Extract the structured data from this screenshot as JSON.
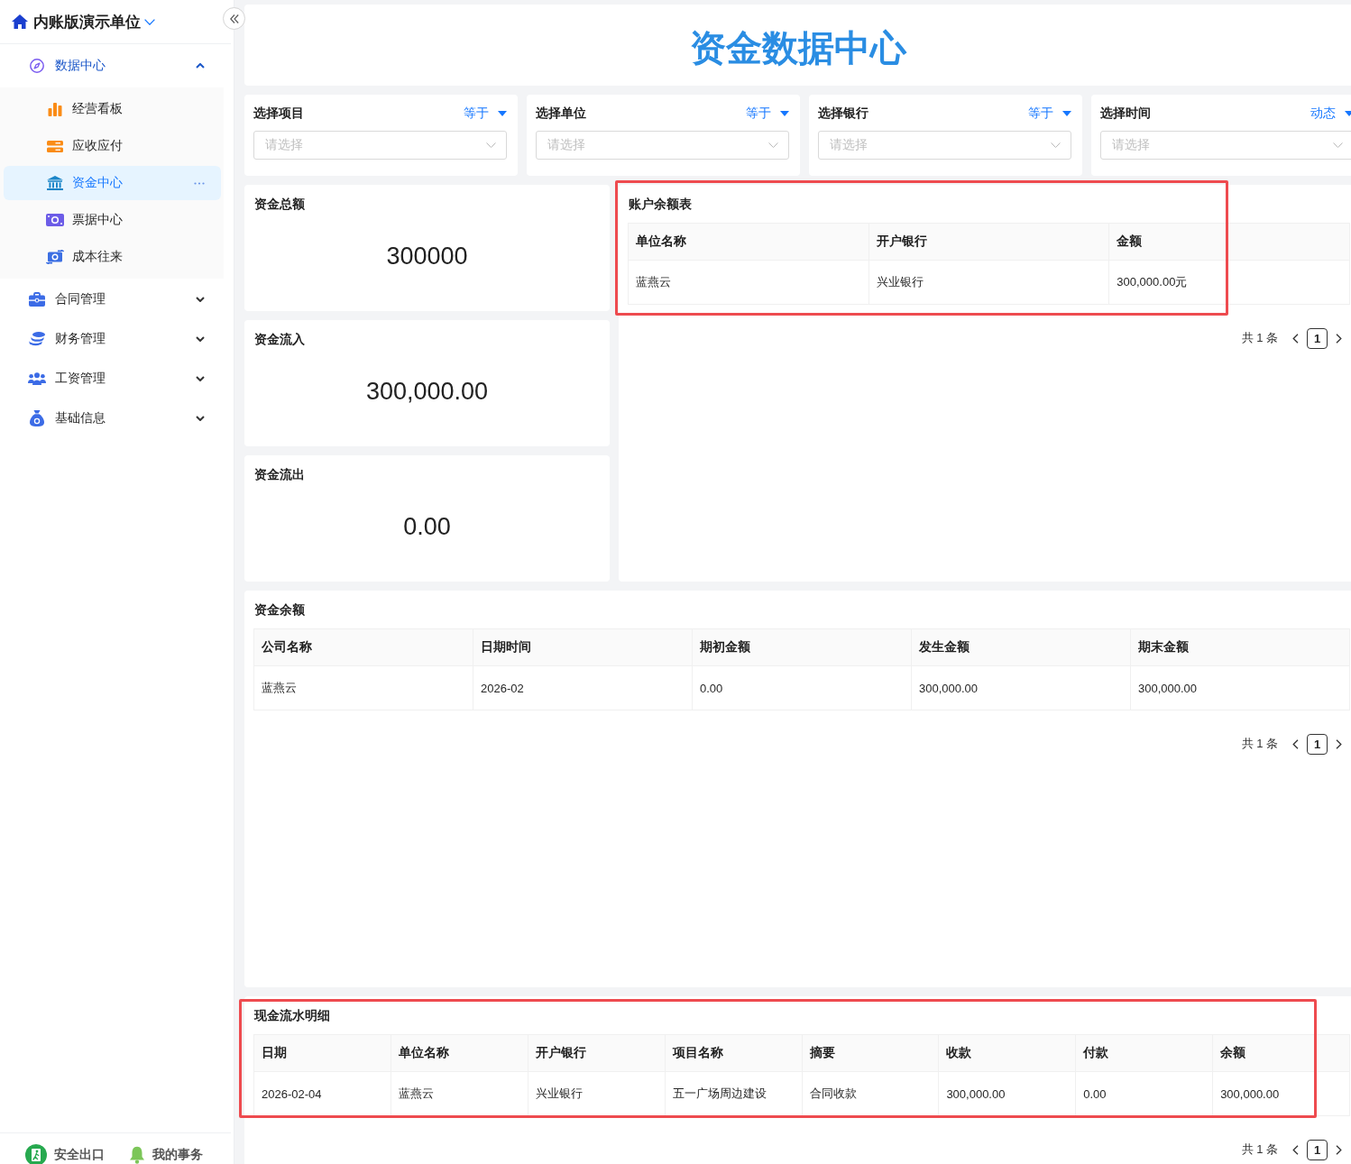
{
  "sidebar": {
    "org_name": "内账版演示单位",
    "menu": [
      {
        "label": "数据中心",
        "expanded": true,
        "children": [
          {
            "label": "经营看板",
            "selected": false
          },
          {
            "label": "应收应付",
            "selected": false
          },
          {
            "label": "资金中心",
            "selected": true
          },
          {
            "label": "票据中心",
            "selected": false
          },
          {
            "label": "成本往来",
            "selected": false
          }
        ]
      },
      {
        "label": "合同管理",
        "expanded": false
      },
      {
        "label": "财务管理",
        "expanded": false
      },
      {
        "label": "工资管理",
        "expanded": false
      },
      {
        "label": "基础信息",
        "expanded": false
      }
    ],
    "footer": [
      {
        "label": "安全出口"
      },
      {
        "label": "我的事务"
      }
    ]
  },
  "page_title": "资金数据中心",
  "filters": [
    {
      "label": "选择项目",
      "operator": "等于",
      "placeholder": "请选择"
    },
    {
      "label": "选择单位",
      "operator": "等于",
      "placeholder": "请选择"
    },
    {
      "label": "选择银行",
      "operator": "等于",
      "placeholder": "请选择"
    },
    {
      "label": "选择时间",
      "operator": "动态",
      "placeholder": "请选择"
    }
  ],
  "stats": [
    {
      "title": "资金总额",
      "value": "300000"
    },
    {
      "title": "资金流入",
      "value": "300,000.00"
    },
    {
      "title": "资金流出",
      "value": "0.00"
    }
  ],
  "account_balance": {
    "title": "账户余额表",
    "highlighted": true,
    "columns": [
      "单位名称",
      "开户银行",
      "金额"
    ],
    "rows": [
      [
        "蓝燕云",
        "兴业银行",
        "300,000.00元"
      ]
    ],
    "pagination": {
      "summary": "共 1 条",
      "pages": [
        {
          "label": "1",
          "selected": true
        }
      ]
    }
  },
  "fund_balance": {
    "title": "资金余额",
    "columns": [
      "公司名称",
      "日期时间",
      "期初金额",
      "发生金额",
      "期末金额"
    ],
    "rows": [
      [
        "蓝燕云",
        "2026-02",
        "0.00",
        "300,000.00",
        "300,000.00"
      ]
    ],
    "pagination": {
      "summary": "共 1 条",
      "pages": [
        {
          "label": "1",
          "selected": true
        }
      ]
    }
  },
  "cash_flow": {
    "title": "现金流水明细",
    "highlighted": true,
    "columns": [
      "日期",
      "单位名称",
      "开户银行",
      "项目名称",
      "摘要",
      "收款",
      "付款",
      "余额"
    ],
    "rows": [
      [
        "2026-02-04",
        "蓝燕云",
        "兴业银行",
        "五一广场周边建设",
        "合同收款",
        "300,000.00",
        "0.00",
        "300,000.00"
      ]
    ],
    "pagination": {
      "summary": "共 1 条",
      "pages": [
        {
          "label": "1",
          "selected": true
        }
      ]
    }
  }
}
